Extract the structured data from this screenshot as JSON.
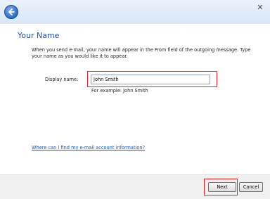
{
  "window": {
    "close_glyph": "✕"
  },
  "heading": "Your Name",
  "instructions": "When you send e-mail, your name will appear in the From field of the outgoing message. Type your name as you would like it to appear.",
  "display_name": {
    "label": "Display name:",
    "value": "John Smith",
    "example": "For example: John Smith"
  },
  "help_link": "Where can I find my e-mail account information?",
  "buttons": {
    "next": "Next",
    "cancel": "Cancel"
  },
  "colors": {
    "heading": "#1f4fa6",
    "link": "#1a56c8",
    "highlight": "#d62828"
  }
}
